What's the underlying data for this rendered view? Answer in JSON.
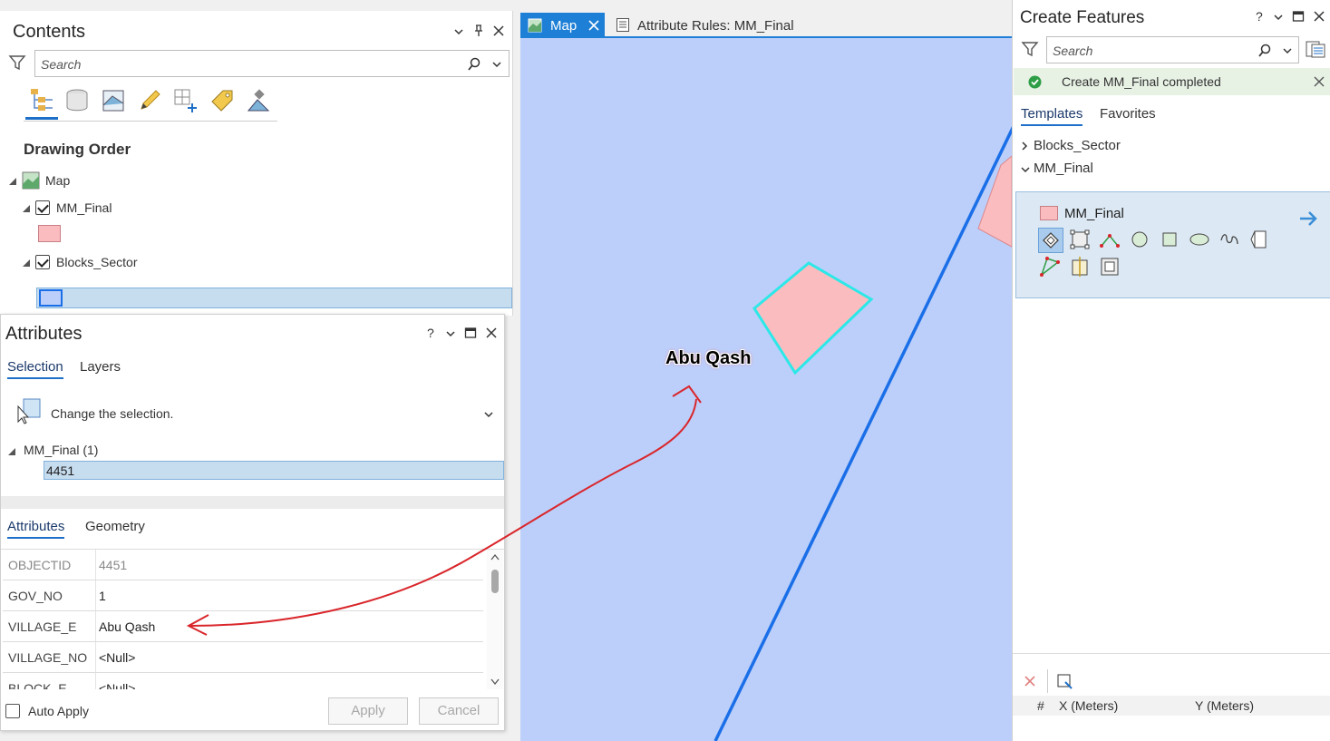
{
  "contents": {
    "title": "Contents",
    "search_placeholder": "Search",
    "drawing_order": "Drawing Order",
    "tree": {
      "map": "Map",
      "layer1": "MM_Final",
      "layer2": "Blocks_Sector"
    }
  },
  "attributes": {
    "title": "Attributes",
    "help": "?",
    "tabs": [
      "Selection",
      "Layers"
    ],
    "change_selection": "Change the selection.",
    "group": "MM_Final (1)",
    "selected_id": "4451",
    "subtabs": [
      "Attributes",
      "Geometry"
    ],
    "rows": [
      {
        "key": "OBJECTID",
        "value": "4451"
      },
      {
        "key": "GOV_NO",
        "value": "1"
      },
      {
        "key": "VILLAGE_E",
        "value": "Abu Qash"
      },
      {
        "key": "VILLAGE_NO",
        "value": "<Null>"
      },
      {
        "key": "BLOCK_E",
        "value": "<Null>"
      }
    ],
    "auto_apply": "Auto Apply",
    "apply": "Apply",
    "cancel": "Cancel"
  },
  "map_tabs": {
    "map": "Map",
    "attribute_rules": "Attribute Rules: MM_Final"
  },
  "map": {
    "label": "Abu Qash",
    "colors": {
      "background": "#bccffa",
      "polygon_fill": "#fbbcbf",
      "selection": "#2ce8e8",
      "line": "#1a6fe8",
      "annotation": "#d9262b"
    }
  },
  "create_features": {
    "title": "Create Features",
    "help": "?",
    "search_placeholder": "Search",
    "banner": "Create MM_Final completed",
    "tabs": [
      "Templates",
      "Favorites"
    ],
    "groups": [
      "Blocks_Sector",
      "MM_Final"
    ],
    "template": "MM_Final",
    "coords_header": {
      "hash": "#",
      "x": "X (Meters)",
      "y": "Y (Meters)"
    }
  }
}
